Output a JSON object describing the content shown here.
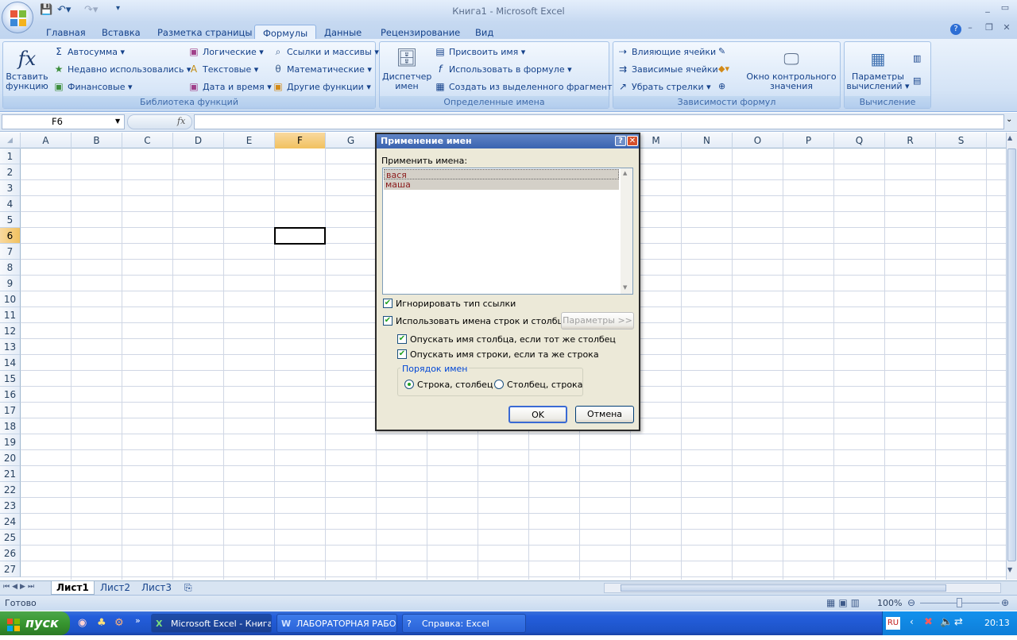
{
  "window": {
    "title": "Книга1 - Microsoft Excel"
  },
  "ribbon": {
    "tabs": [
      {
        "label": "Главная"
      },
      {
        "label": "Вставка"
      },
      {
        "label": "Разметка страницы"
      },
      {
        "label": "Формулы"
      },
      {
        "label": "Данные"
      },
      {
        "label": "Рецензирование"
      },
      {
        "label": "Вид"
      }
    ],
    "active_tab": "Формулы",
    "groups": {
      "library": {
        "label": "Библиотека функций",
        "insert_function": [
          "Вставить",
          "функцию"
        ],
        "buttons": [
          "Автосумма",
          "Недавно использовались",
          "Финансовые",
          "Логические",
          "Текстовые",
          "Дата и время",
          "Ссылки и массивы",
          "Математические",
          "Другие функции"
        ]
      },
      "names": {
        "label": "Определенные имена",
        "manager": [
          "Диспетчер",
          "имен"
        ],
        "buttons": [
          "Присвоить имя",
          "Использовать в формуле",
          "Создать из выделенного фрагмента"
        ]
      },
      "audit": {
        "label": "Зависимости формул",
        "buttons": [
          "Влияющие ячейки",
          "Зависимые ячейки",
          "Убрать стрелки"
        ],
        "watch": [
          "Окно контрольного",
          "значения"
        ]
      },
      "calc": {
        "label": "Вычисление",
        "options": [
          "Параметры",
          "вычислений"
        ]
      }
    }
  },
  "formula_bar": {
    "name_box": "F6",
    "fx": "fx",
    "value": ""
  },
  "grid": {
    "columns": [
      "A",
      "B",
      "C",
      "D",
      "E",
      "F",
      "G",
      "H",
      "I",
      "J",
      "K",
      "L",
      "M",
      "N",
      "O",
      "P",
      "Q",
      "R",
      "S"
    ],
    "rows": [
      "1",
      "2",
      "3",
      "4",
      "5",
      "6",
      "7",
      "8",
      "9",
      "10",
      "11",
      "12",
      "13",
      "14",
      "15",
      "16",
      "17",
      "18",
      "19",
      "20",
      "21",
      "22",
      "23",
      "24",
      "25",
      "26",
      "27"
    ],
    "selected_column": "F",
    "selected_row": "6"
  },
  "sheets": [
    {
      "label": "Лист1"
    },
    {
      "label": "Лист2"
    },
    {
      "label": "Лист3"
    }
  ],
  "active_sheet": "Лист1",
  "status": {
    "text": "Готово",
    "zoom": "100%"
  },
  "dialog": {
    "title": "Применение имен",
    "names_label": "Применить имена:",
    "names": [
      "вася",
      "маша"
    ],
    "ignore_ref_type": {
      "label": "Игнорировать тип ссылки",
      "checked": true
    },
    "use_row_col_names": {
      "label": "Использовать имена строк и столбцов",
      "checked": true
    },
    "params_button": "Параметры >>",
    "omit_col_name": {
      "label": "Опускать имя столбца, если тот же столбец",
      "checked": true
    },
    "omit_row_name": {
      "label": "Опускать имя строки, если та же строка",
      "checked": true
    },
    "order_label": "Порядок имен",
    "order_options": [
      {
        "label": "Строка, столбец",
        "selected": true
      },
      {
        "label": "Столбец, строка",
        "selected": false
      }
    ],
    "ok": "OK",
    "cancel": "Отмена"
  },
  "taskbar": {
    "start": "пуск",
    "tasks": [
      {
        "label": "Microsoft Excel - Книга1",
        "active": true
      },
      {
        "label": "ЛАБОРАТОРНАЯ РАБО...",
        "active": false
      },
      {
        "label": "Справка: Excel",
        "active": false
      }
    ],
    "lang": "RU",
    "clock": "20:13"
  },
  "colors": {
    "selection_header": "#f1c15f",
    "ribbon_bg": "#d5e4f6",
    "taskbar": "#245edc",
    "start": "#37962f"
  }
}
